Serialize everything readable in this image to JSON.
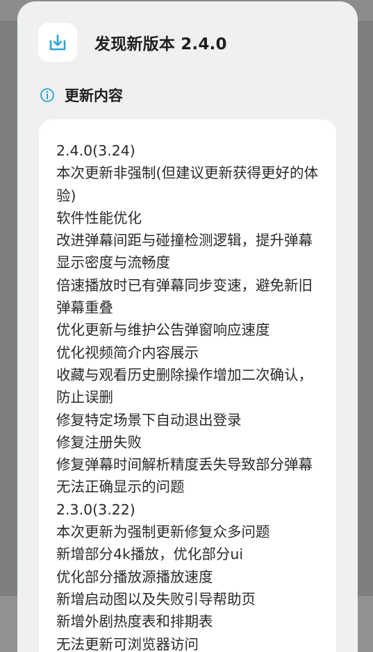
{
  "dialog": {
    "title": "发现新版本 2.4.0",
    "icon": "download-icon",
    "section": {
      "icon": "info-icon",
      "title": "更新内容"
    },
    "notes": [
      "2.4.0(3.24)",
      "本次更新非强制(但建议更新获得更好的体验)",
      "软件性能优化",
      "改进弹幕间距与碰撞检测逻辑，提升弹幕显示密度与流畅度",
      "倍速播放时已有弹幕同步变速，避免新旧弹幕重叠",
      "优化更新与维护公告弹窗响应速度",
      "优化视频简介内容展示",
      "收藏与观看历史删除操作增加二次确认，防止误删",
      "修复特定场景下自动退出登录",
      "修复注册失败",
      "修复弹幕时间解析精度丢失导致部分弹幕无法正确显示的问题",
      "2.3.0(3.22)",
      "本次更新为强制更新修复众多问题",
      "新增部分4k播放，优化部分ui",
      "优化部分播放源播放速度",
      "新增启动图以及失败引导帮助页",
      "新增外剧热度表和排期表",
      "无法更新可浏览器访问"
    ]
  },
  "colors": {
    "accent": "#29a3d9",
    "dialog_bg": "#eff0f2",
    "card_bg": "#ffffff",
    "text": "#2a2a2a"
  }
}
